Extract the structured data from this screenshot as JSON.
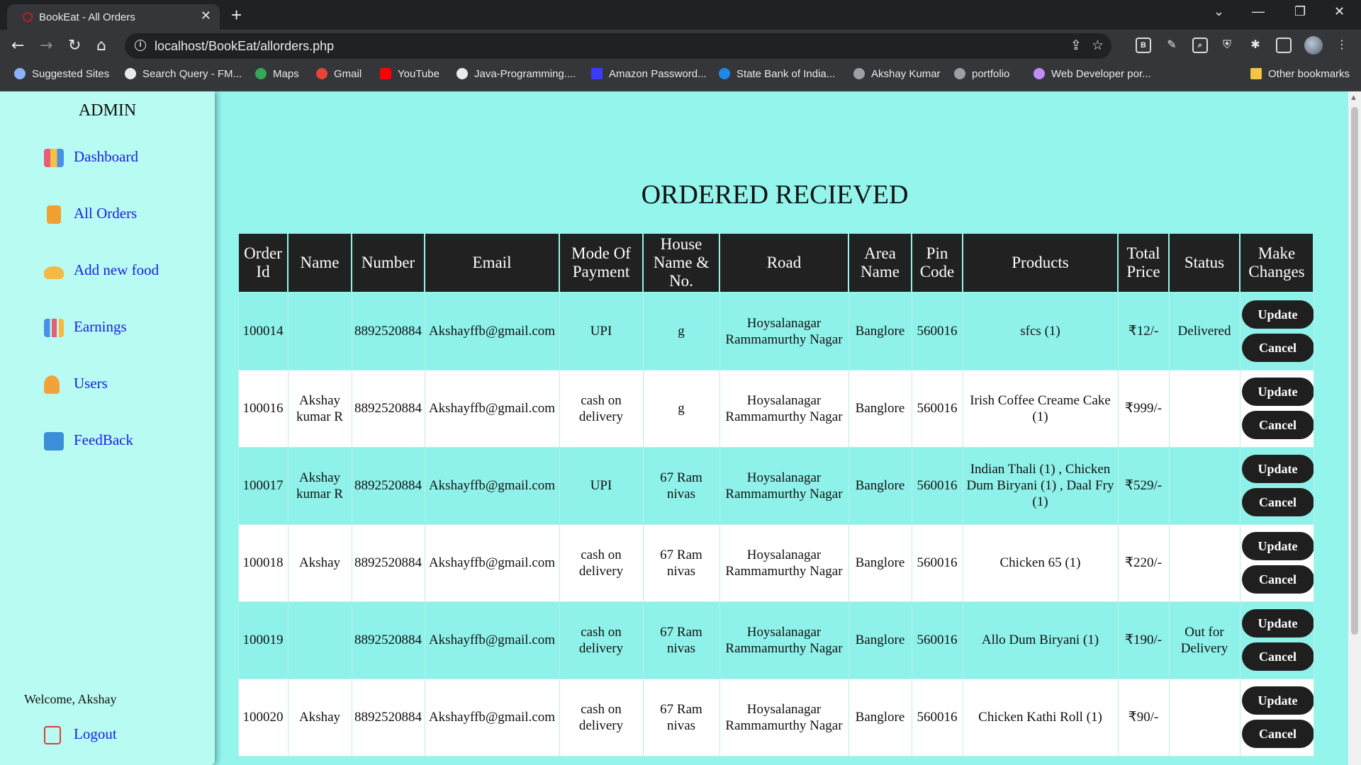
{
  "browser": {
    "tab_title": "BookEat - All Orders",
    "url": "localhost/BookEat/allorders.php",
    "bookmarks": [
      {
        "label": "Suggested Sites",
        "color": "#8ab4f8"
      },
      {
        "label": "Search Query - FM...",
        "color": "#e8eaed"
      },
      {
        "label": "Maps",
        "color": "#34a853"
      },
      {
        "label": "Gmail",
        "color": "#ea4335"
      },
      {
        "label": "YouTube",
        "color": "#ff0000"
      },
      {
        "label": "Java-Programming....",
        "color": "#e8eaed"
      },
      {
        "label": "Amazon Password...",
        "color": "#3b3bff"
      },
      {
        "label": "State Bank of India...",
        "color": "#1f8ae6"
      },
      {
        "label": "Akshay Kumar",
        "color": "#9aa0a6"
      },
      {
        "label": "portfolio",
        "color": "#9aa0a6"
      },
      {
        "label": "Web Developer por...",
        "color": "#c58af9"
      }
    ],
    "other_bookmarks": "Other bookmarks",
    "ext_label": "B"
  },
  "sidebar": {
    "title": "ADMIN",
    "items": [
      {
        "label": "Dashboard",
        "icon": "dashboard-icon",
        "color": "#e85d75"
      },
      {
        "label": "All Orders",
        "icon": "orders-icon",
        "color": "#f0a030"
      },
      {
        "label": "Add new food",
        "icon": "food-icon",
        "color": "#f5b942"
      },
      {
        "label": "Earnings",
        "icon": "earnings-icon",
        "color": "#4a90e2"
      },
      {
        "label": "Users",
        "icon": "users-icon",
        "color": "#f2a23a"
      },
      {
        "label": "FeedBack",
        "icon": "feedback-icon",
        "color": "#3a8fd8"
      }
    ],
    "welcome": "Welcome, Akshay",
    "logout": "Logout"
  },
  "main": {
    "heading": "ORDERED RECIEVED",
    "columns": [
      "Order Id",
      "Name",
      "Number",
      "Email",
      "Mode Of Payment",
      "House Name & No.",
      "Road",
      "Area Name",
      "Pin Code",
      "Products",
      "Total Price",
      "Status",
      "Make Changes"
    ],
    "update_label": "Update",
    "cancel_label": "Cancel",
    "orders": [
      {
        "id": "100014",
        "name": "",
        "number": "8892520884",
        "email": "Akshayffb@gmail.com",
        "payment": "UPI",
        "house": "g",
        "road": "Hoysalanagar Rammamurthy Nagar",
        "area": "Banglore",
        "pin": "560016",
        "products": "sfcs (1)",
        "price": "₹12/-",
        "status": "Delivered"
      },
      {
        "id": "100016",
        "name": "Akshay kumar R",
        "number": "8892520884",
        "email": "Akshayffb@gmail.com",
        "payment": "cash on delivery",
        "house": "g",
        "road": "Hoysalanagar Rammamurthy Nagar",
        "area": "Banglore",
        "pin": "560016",
        "products": "Irish Coffee Creame Cake (1)",
        "price": "₹999/-",
        "status": ""
      },
      {
        "id": "100017",
        "name": "Akshay kumar R",
        "number": "8892520884",
        "email": "Akshayffb@gmail.com",
        "payment": "UPI",
        "house": "67 Ram nivas",
        "road": "Hoysalanagar Rammamurthy Nagar",
        "area": "Banglore",
        "pin": "560016",
        "products": "Indian Thali (1) , Chicken Dum Biryani (1) , Daal Fry (1)",
        "price": "₹529/-",
        "status": ""
      },
      {
        "id": "100018",
        "name": "Akshay",
        "number": "8892520884",
        "email": "Akshayffb@gmail.com",
        "payment": "cash on delivery",
        "house": "67 Ram nivas",
        "road": "Hoysalanagar Rammamurthy Nagar",
        "area": "Banglore",
        "pin": "560016",
        "products": "Chicken 65 (1)",
        "price": "₹220/-",
        "status": ""
      },
      {
        "id": "100019",
        "name": "",
        "number": "8892520884",
        "email": "Akshayffb@gmail.com",
        "payment": "cash on delivery",
        "house": "67 Ram nivas",
        "road": "Hoysalanagar Rammamurthy Nagar",
        "area": "Banglore",
        "pin": "560016",
        "products": "Allo Dum Biryani (1)",
        "price": "₹190/-",
        "status": "Out for Delivery"
      },
      {
        "id": "100020",
        "name": "Akshay",
        "number": "8892520884",
        "email": "Akshayffb@gmail.com",
        "payment": "cash on delivery",
        "house": "67 Ram nivas",
        "road": "Hoysalanagar Rammamurthy Nagar",
        "area": "Banglore",
        "pin": "560016",
        "products": "Chicken Kathi Roll (1)",
        "price": "₹90/-",
        "status": ""
      }
    ]
  }
}
